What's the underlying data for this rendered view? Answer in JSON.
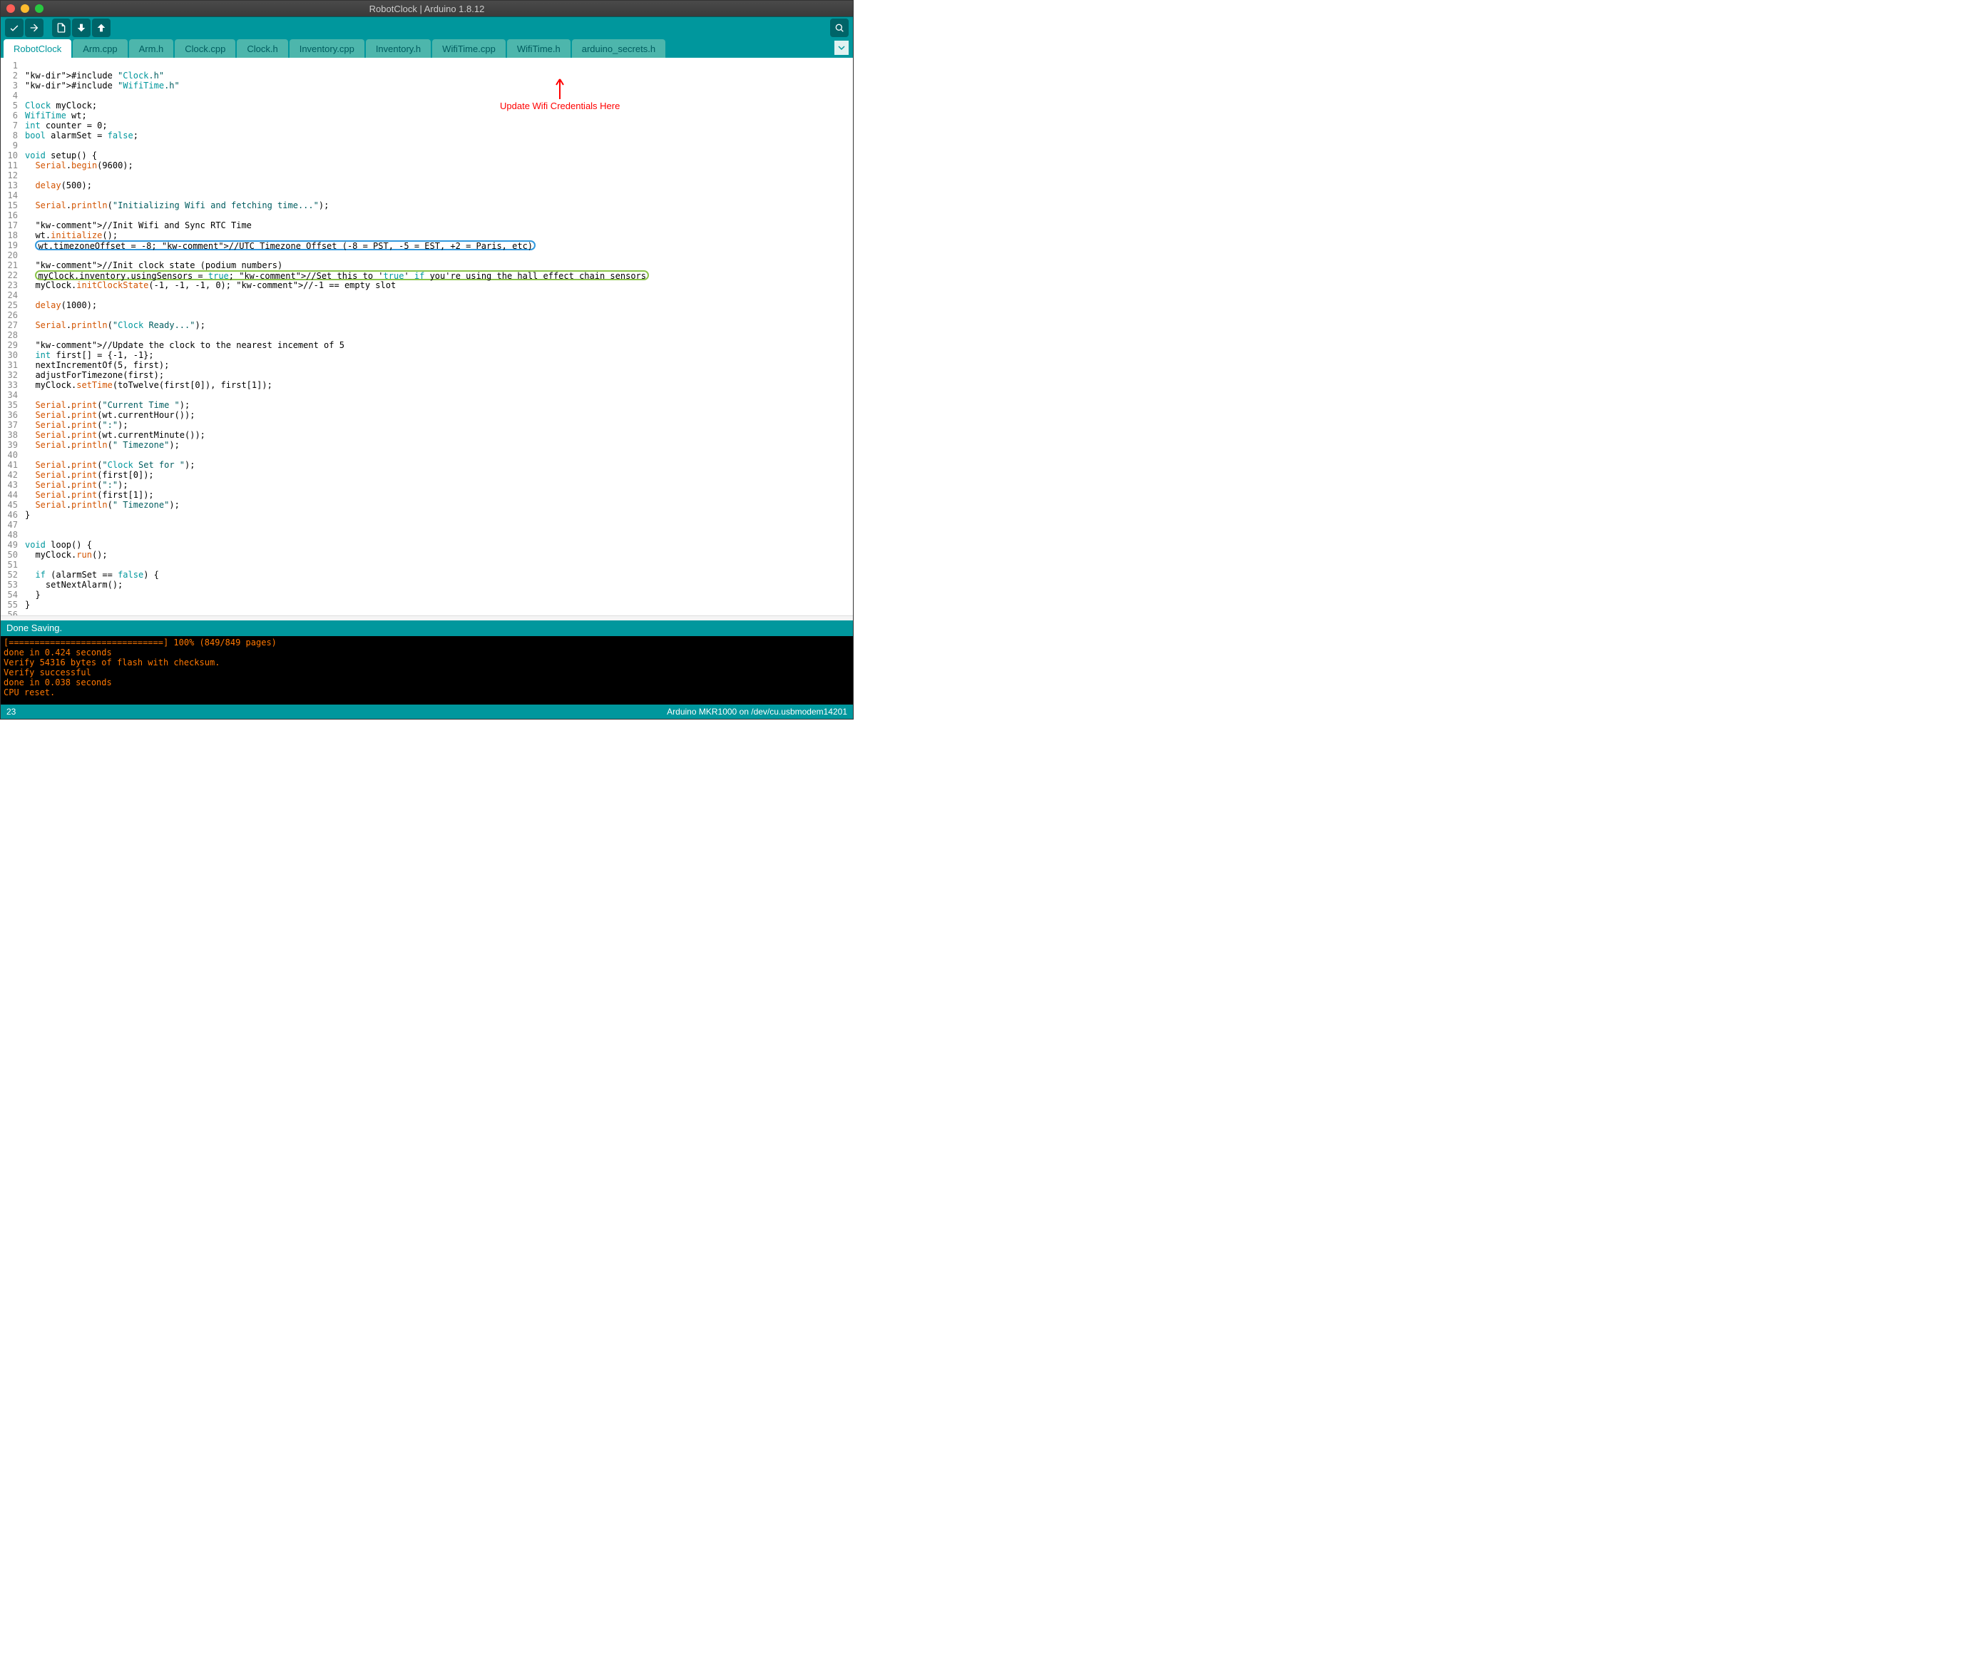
{
  "window": {
    "title": "RobotClock | Arduino 1.8.12"
  },
  "toolbar": {
    "verify": "Verify",
    "upload": "Upload",
    "new": "New",
    "open": "Open",
    "save": "Save",
    "monitor": "Serial Monitor"
  },
  "tabs": [
    {
      "label": "RobotClock",
      "active": true
    },
    {
      "label": "Arm.cpp"
    },
    {
      "label": "Arm.h"
    },
    {
      "label": "Clock.cpp"
    },
    {
      "label": "Clock.h"
    },
    {
      "label": "Inventory.cpp"
    },
    {
      "label": "Inventory.h"
    },
    {
      "label": "WifiTime.cpp"
    },
    {
      "label": "WifiTime.h"
    },
    {
      "label": "arduino_secrets.h"
    }
  ],
  "annotation": {
    "text": "Update Wifi Credentials Here"
  },
  "code_lines": [
    "",
    "#include \"Clock.h\"",
    "#include \"WifiTime.h\"",
    "",
    "Clock myClock;",
    "WifiTime wt;",
    "int counter = 0;",
    "bool alarmSet = false;",
    "",
    "void setup() {",
    "  Serial.begin(9600);",
    "",
    "  delay(500);",
    "",
    "  Serial.println(\"Initializing Wifi and fetching time...\");",
    "",
    "  //Init Wifi and Sync RTC Time",
    "  wt.initialize();",
    "  wt.timezoneOffset = -8; //UTC Timezone Offset (-8 = PST, -5 = EST, +2 = Paris, etc)",
    "",
    "  //Init clock state (podium numbers)",
    "  myClock.inventory.usingSensors = true; //Set this to 'true' if you're using the hall effect chain sensors",
    "  myClock.initClockState(-1, -1, -1, 0); //-1 == empty slot",
    "",
    "  delay(1000);",
    "",
    "  Serial.println(\"Clock Ready...\");",
    "",
    "  //Update the clock to the nearest incement of 5",
    "  int first[] = {-1, -1};",
    "  nextIncrementOf(5, first);",
    "  adjustForTimezone(first);",
    "  myClock.setTime(toTwelve(first[0]), first[1]);",
    "",
    "  Serial.print(\"Current Time \");",
    "  Serial.print(wt.currentHour());",
    "  Serial.print(\":\");",
    "  Serial.print(wt.currentMinute());",
    "  Serial.println(\" Timezone\");",
    "",
    "  Serial.print(\"Clock Set for \");",
    "  Serial.print(first[0]);",
    "  Serial.print(\":\");",
    "  Serial.print(first[1]);",
    "  Serial.println(\" Timezone\");",
    "}",
    "",
    "",
    "void loop() {",
    "  myClock.run();",
    "",
    "  if (alarmSet == false) {",
    "    setNextAlarm();",
    "  }",
    "}",
    ""
  ],
  "status": {
    "message": "Done Saving."
  },
  "console": [
    "[==============================] 100% (849/849 pages)",
    "done in 0.424 seconds",
    "",
    "Verify 54316 bytes of flash with checksum.",
    "Verify successful",
    "done in 0.038 seconds",
    "CPU reset."
  ],
  "footer": {
    "line": "23",
    "board": "Arduino MKR1000 on /dev/cu.usbmodem14201"
  }
}
